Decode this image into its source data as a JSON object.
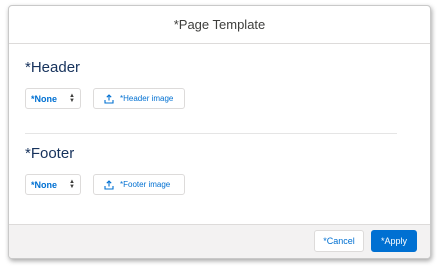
{
  "dialog": {
    "title": "*Page Template"
  },
  "header_section": {
    "title": "*Header",
    "select_value": "*None",
    "upload_label": "*Header image"
  },
  "footer_section": {
    "title": "*Footer",
    "select_value": "*None",
    "upload_label": "*Footer image"
  },
  "footer_bar": {
    "cancel_label": "*Cancel",
    "apply_label": "*Apply"
  },
  "icons": {
    "select_arrows": "up-down-arrows-icon",
    "upload": "upload-icon"
  },
  "colors": {
    "accent": "#0070d2",
    "text": "#16325c",
    "border": "#dddbda",
    "footer_bg": "#f3f2f2"
  }
}
